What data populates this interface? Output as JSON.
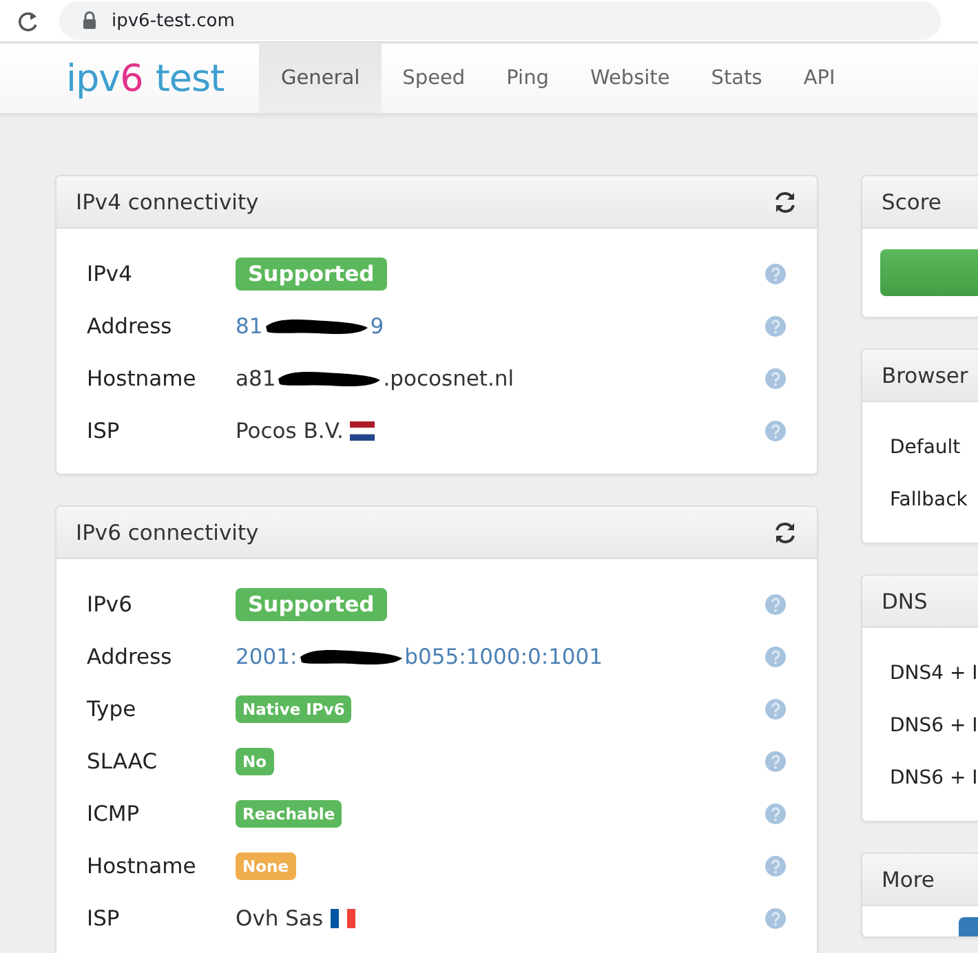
{
  "browser": {
    "url": "ipv6-test.com"
  },
  "site": {
    "logo": [
      {
        "text": "ipv",
        "color": "#3d9fcf"
      },
      {
        "text": "6",
        "color": "#e2338b"
      },
      {
        "text": "test",
        "color": "#3d9fcf"
      }
    ],
    "tabs": [
      {
        "label": "General",
        "selected": true
      },
      {
        "label": "Speed",
        "selected": false
      },
      {
        "label": "Ping",
        "selected": false
      },
      {
        "label": "Website",
        "selected": false
      },
      {
        "label": "Stats",
        "selected": false
      },
      {
        "label": "API",
        "selected": false
      }
    ]
  },
  "panels": [
    {
      "title": "IPv4 connectivity",
      "rows": [
        {
          "label": "IPv4",
          "value": {
            "kind": "bigbadge",
            "text": "Supported",
            "color": "#5cb85c"
          }
        },
        {
          "label": "Address",
          "value": {
            "kind": "redacted-link",
            "start": "81",
            "end": "9"
          }
        },
        {
          "label": "Hostname",
          "value": {
            "kind": "redacted-text",
            "start": "a81",
            "end": ".pocosnet.nl"
          }
        },
        {
          "label": "ISP",
          "value": {
            "kind": "text",
            "text": "Pocos B.V."
          }
        }
      ]
    },
    {
      "title": "IPv6 connectivity",
      "rows": [
        {
          "label": "IPv6",
          "value": {
            "kind": "bigbadge",
            "text": "Supported",
            "color": "#5cb85c"
          }
        },
        {
          "label": "Address",
          "value": {
            "kind": "redacted-link",
            "start": "2001:",
            "end": "b055:1000:0:1001"
          }
        },
        {
          "label": "Type",
          "value": {
            "kind": "badge",
            "text": "Native IPv6",
            "color": "#5cb85c"
          }
        },
        {
          "label": "SLAAC",
          "value": {
            "kind": "badge",
            "text": "No",
            "color": "#5cb85c"
          }
        },
        {
          "label": "ICMP",
          "value": {
            "kind": "badge",
            "text": "Reachable",
            "color": "#5cb85c"
          }
        },
        {
          "label": "Hostname",
          "value": {
            "kind": "badge",
            "text": "None",
            "color": "#f0ad4e"
          }
        },
        {
          "label": "ISP",
          "value": {
            "kind": "text",
            "text": "Ovh Sas"
          }
        }
      ]
    }
  ],
  "side_panels": [
    {
      "title": "Score",
      "kind": "bar"
    },
    {
      "title": "Browser",
      "kind": "rows",
      "rows": [
        "Default",
        "Fallback"
      ]
    },
    {
      "title": "DNS",
      "kind": "rows",
      "rows": [
        "DNS4 + I",
        "DNS6 + I",
        "DNS6 + I"
      ]
    },
    {
      "title": "More",
      "kind": "button"
    }
  ]
}
